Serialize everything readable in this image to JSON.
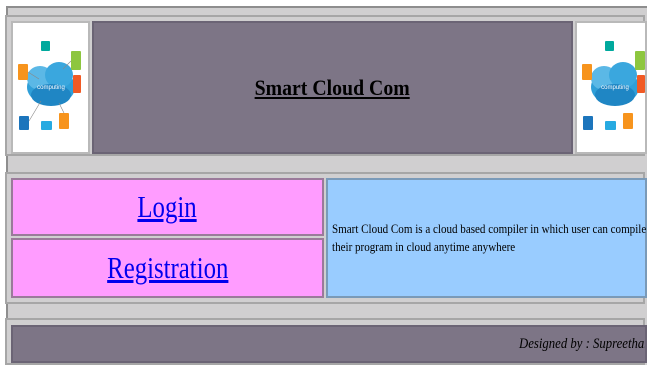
{
  "header": {
    "title": "Smart Cloud Com",
    "logo_left_icon": "cloud-computing-logo",
    "logo_right_icon": "cloud-computing-logo"
  },
  "nav": {
    "login_label": "Login",
    "registration_label": "Registration"
  },
  "description": "Smart Cloud Com is a cloud  based compiler in which user can compile their program in cloud anytime anywhere",
  "footer": {
    "credit": "Designed by : Supreetha.B"
  },
  "colors": {
    "header_bg": "#7d7586",
    "nav_bg": "#ff9cff",
    "desc_bg": "#99ccff",
    "frame_bg": "#d0cfd0",
    "link": "#0000ee"
  }
}
